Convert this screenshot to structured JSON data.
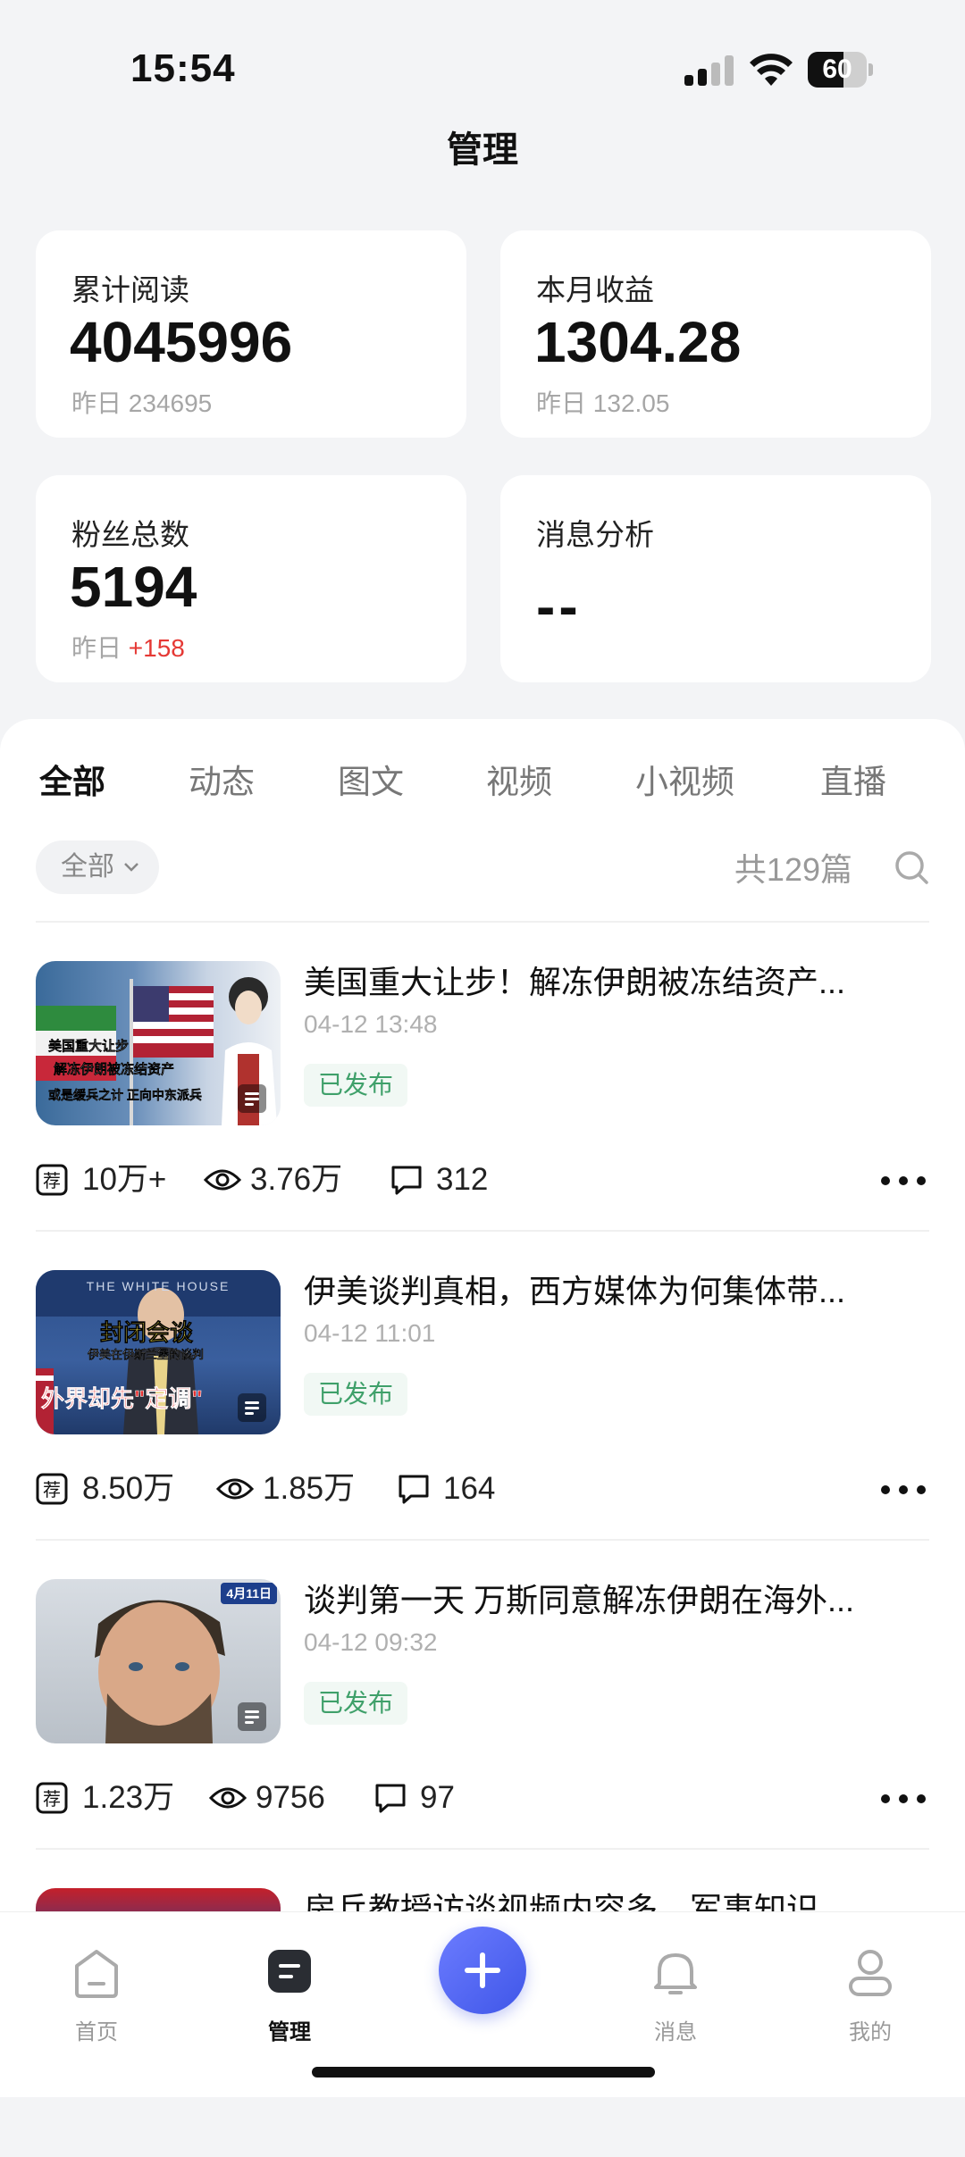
{
  "status_bar": {
    "time": "15:54",
    "battery": "60",
    "battery_level_percent": 60
  },
  "header": {
    "title": "管理"
  },
  "stats": {
    "total_reads": {
      "label": "累计阅读",
      "value": "4045996",
      "sub_label": "昨日",
      "sub_value": "234695"
    },
    "monthly_income": {
      "label": "本月收益",
      "value": "1304.28",
      "sub_label": "昨日",
      "sub_value": "132.05"
    },
    "fans": {
      "label": "粉丝总数",
      "value": "5194",
      "sub_label": "昨日",
      "sub_value": "+158"
    },
    "message_analysis": {
      "label": "消息分析",
      "value": "--"
    }
  },
  "tabs": [
    {
      "label": "全部",
      "active": true
    },
    {
      "label": "动态"
    },
    {
      "label": "图文"
    },
    {
      "label": "视频"
    },
    {
      "label": "小视频"
    },
    {
      "label": "直播"
    }
  ],
  "filter": {
    "selected": "全部",
    "count_text": "共129篇"
  },
  "articles": [
    {
      "title": "美国重大让步！解冻伊朗被冻结资产...",
      "date": "04-12 13:48",
      "status": "已发布",
      "recommend": "10万+",
      "views": "3.76万",
      "comments": "312",
      "thumb_caption": [
        "美国重大让步",
        "解冻伊朗被冻结资产",
        "或是缓兵之计 正向中东派兵"
      ]
    },
    {
      "title": "伊美谈判真相，西方媒体为何集体带...",
      "date": "04-12 11:01",
      "status": "已发布",
      "recommend": "8.50万",
      "views": "1.85万",
      "comments": "164",
      "thumb_caption": [
        "THE WHITE HOUSE",
        "封闭会谈",
        "伊美在伊斯兰堡的谈判",
        "外界却先\"定调\""
      ]
    },
    {
      "title": "谈判第一天 万斯同意解冻伊朗在海外...",
      "date": "04-12 09:32",
      "status": "已发布",
      "recommend": "1.23万",
      "views": "9756",
      "comments": "97",
      "thumb_caption": [
        "4月11日"
      ]
    },
    {
      "title": "房兵教授访谈视频内容多，军事知识"
    }
  ],
  "nav": {
    "home": "首页",
    "manage": "管理",
    "messages": "消息",
    "mine": "我的"
  },
  "colors": {
    "accent": "#4a5cf0",
    "published_green": "#3fa06a",
    "positive_red": "#e53935"
  }
}
